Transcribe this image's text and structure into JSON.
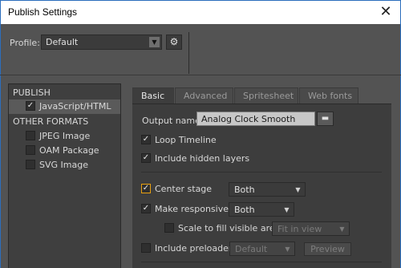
{
  "window": {
    "title": "Publish Settings",
    "close_glyph": "✕"
  },
  "profile": {
    "label": "Profile:",
    "value": "Default",
    "arrow_icon": "chevron-down-icon",
    "gear_icon": "gear-icon"
  },
  "sidebar": {
    "publish_group": "PUBLISH",
    "publish_items": [
      {
        "label": "JavaScript/HTML",
        "checked": true,
        "selected": true
      }
    ],
    "other_group": "OTHER FORMATS",
    "other_items": [
      {
        "label": "JPEG Image",
        "checked": false
      },
      {
        "label": "OAM Package",
        "checked": false
      },
      {
        "label": "SVG Image",
        "checked": false
      }
    ]
  },
  "tabs": [
    {
      "label": "Basic",
      "active": true
    },
    {
      "label": "Advanced",
      "active": false
    },
    {
      "label": "Spritesheet",
      "active": false
    },
    {
      "label": "Web fonts",
      "active": false
    }
  ],
  "basic": {
    "output_label": "Output name:",
    "output_value": "Analog Clock Smooth",
    "loop_timeline": {
      "label": "Loop Timeline",
      "checked": true
    },
    "include_hidden": {
      "label": "Include hidden layers",
      "checked": true
    },
    "center_stage": {
      "label": "Center stage",
      "checked": true,
      "option": "Both"
    },
    "make_responsive": {
      "label": "Make responsive",
      "checked": true,
      "option": "Both"
    },
    "scale_to_fill": {
      "label": "Scale to fill visible area",
      "checked": false,
      "option": "Fit in view"
    },
    "include_preloader": {
      "label": "Include preloader",
      "checked": false,
      "option": "Default",
      "preview_label": "Preview"
    }
  },
  "colors": {
    "highlight": "#e8a010",
    "accent_border": "#2b6ebd"
  }
}
